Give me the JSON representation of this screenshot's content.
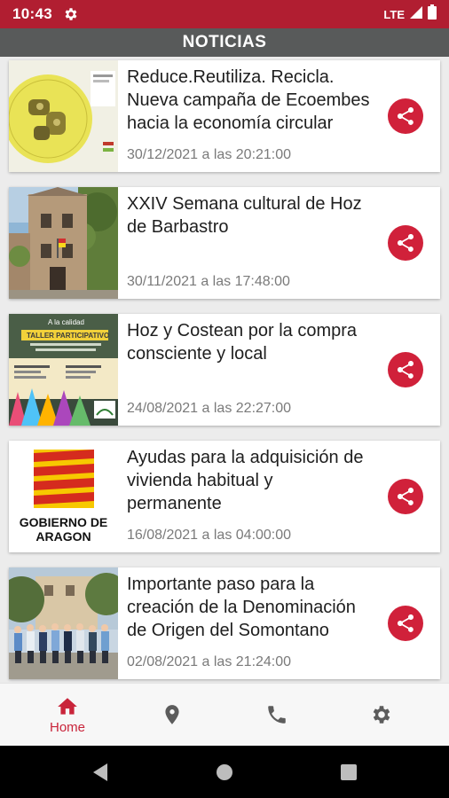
{
  "status_bar": {
    "time": "10:43",
    "network": "LTE"
  },
  "app_bar": {
    "title": "NOTICIAS"
  },
  "news": [
    {
      "title": "Reduce.Reutiliza. Recicla. Nueva campaña de Ecoembes hacia la economía circular",
      "date": "30/12/2021 a las 20:21:00"
    },
    {
      "title": "XXIV Semana cultural de Hoz de Barbastro",
      "date": "30/11/2021 a las 17:48:00"
    },
    {
      "title": "Hoz y Costean por la compra consciente y local",
      "date": "24/08/2021 a las 22:27:00",
      "thumb_text": {
        "top": "A la calidad",
        "banner": "TALLER PARTICIPATIVO"
      }
    },
    {
      "title": "Ayudas para la adquisición de vivienda habitual y permanente",
      "date": "16/08/2021 a las 04:00:00",
      "thumb_text": {
        "line1": "GOBIERNO DE",
        "line2": "ARAGON"
      }
    },
    {
      "title": "Importante paso para la creación de la Denominación de Origen del Somontano",
      "date": "02/08/2021 a las 21:24:00"
    }
  ],
  "bottom_nav": {
    "home_label": "Home"
  },
  "colors": {
    "accent": "#c9243a",
    "status_bar": "#b11e31",
    "app_bar": "#585a5a",
    "share": "#d0213a"
  }
}
